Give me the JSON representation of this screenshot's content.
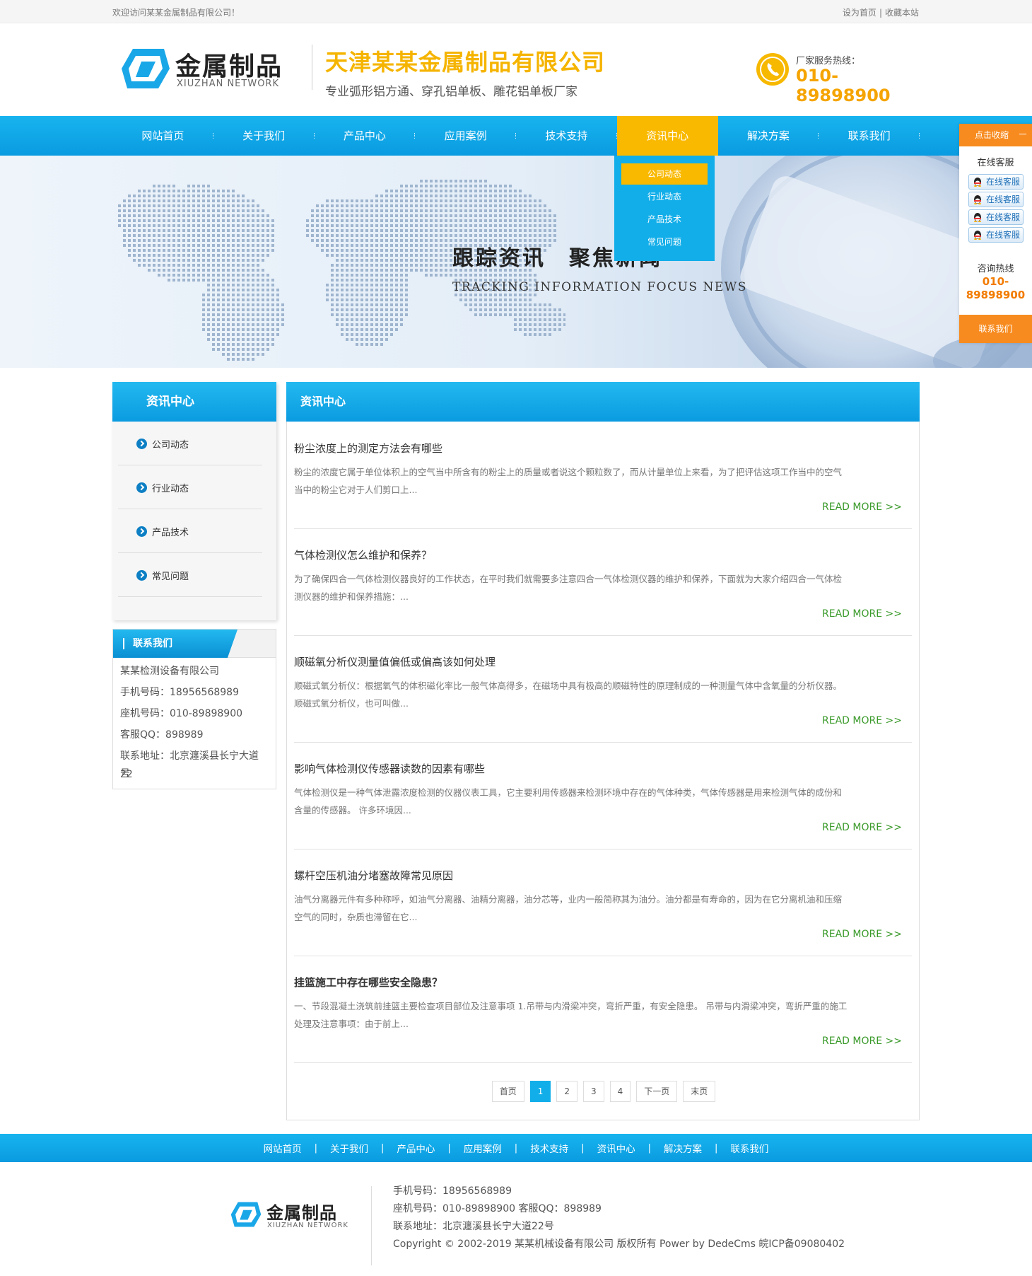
{
  "topbar": {
    "welcome": "欢迎访问某某金属制品有限公司！",
    "set_home": "设为首页",
    "separator": "|",
    "bookmark": "收藏本站"
  },
  "header": {
    "logo_cn": "金属制品",
    "logo_en": "XIUZHAN NETWORK",
    "company_name": "天津某某金属制品有限公司",
    "slogan": "专业弧形铝方通、穿孔铝单板、雕花铝单板厂家",
    "hotline_label": "厂家服务热线：",
    "hotline_number": "010-89898900"
  },
  "nav": {
    "items": [
      {
        "label": "网站首页"
      },
      {
        "label": "关于我们"
      },
      {
        "label": "产品中心"
      },
      {
        "label": "应用案例"
      },
      {
        "label": "技术支持"
      },
      {
        "label": "资讯中心"
      },
      {
        "label": "解决方案"
      },
      {
        "label": "联系我们"
      }
    ],
    "active_index": 5,
    "dropdown": [
      "公司动态",
      "行业动态",
      "产品技术",
      "常见问题"
    ]
  },
  "banner": {
    "title": "跟踪资讯　聚焦新闻",
    "subtitle": "TRACKING INFORMATION FOCUS NEWS"
  },
  "float_widget": {
    "toggle": "点击收缩",
    "toggle_symbol": "－",
    "online_title": "在线客服",
    "qq_buttons": [
      "在线客服",
      "在线客服",
      "在线客服",
      "在线客服"
    ],
    "hotline_label": "咨询热线",
    "hotline_line1": "010-",
    "hotline_line2": "89898900",
    "contact": "联系我们"
  },
  "sidebar": {
    "title": "资讯中心",
    "items": [
      "公司动态",
      "行业动态",
      "产品技术",
      "常见问题"
    ]
  },
  "contact": {
    "title": "联系我们",
    "company": "某某检测设备有限公司",
    "mobile": "手机号码：18956568989",
    "phone": "座机号码：010-89898900",
    "qq": "客服QQ：898989",
    "address_1": "联系地址：北京瀍溪县长宁大道22",
    "address_2": "号"
  },
  "main": {
    "title": "资讯中心",
    "read_more": "READ MORE >>",
    "articles": [
      {
        "title": "粉尘浓度上的测定方法会有哪些",
        "desc_1": "粉尘的浓度它属于单位体积上的空气当中所含有的粉尘上的质量或者说这个颗粒数了，而从计量单位上来看，为了把评估这项工作当中的空气",
        "desc_2": "当中的粉尘它对于人们剪口上..."
      },
      {
        "title": "气体检测仪怎么维护和保养？",
        "desc_1": "为了确保四合一气体检测仪器良好的工作状态，在平时我们就需要多注意四合一气体检测仪器的维护和保养，下面就为大家介绍四合一气体检",
        "desc_2": "测仪器的维护和保养措施：..."
      },
      {
        "title": "顺磁氧分析仪测量值偏低或偏高该如何处理",
        "desc_1": "顺磁式氧分析仪：根据氧气的体积磁化率比一般气体高得多，在磁场中具有极高的顺磁特性的原理制成的一种测量气体中含氧量的分析仪器。",
        "desc_2": "顺磁式氧分析仪，也可叫做..."
      },
      {
        "title": "影响气体检测仪传感器读数的因素有哪些",
        "desc_1": "气体检测仪是一种气体泄露浓度检测的仪器仪表工具，它主要利用传感器来检测环境中存在的气体种类，气体传感器是用来检测气体的成份和",
        "desc_2": "含量的传感器。 许多环境因..."
      },
      {
        "title": "螺杆空压机油分堵塞故障常见原因",
        "desc_1": "油气分离器元件有多种称呼，如油气分离器、油精分离器，油分芯等，业内一般简称其为油分。油分都是有寿命的，因为在它分离机油和压缩",
        "desc_2": "空气的同时，杂质也滞留在它..."
      },
      {
        "title": "挂篮施工中存在哪些安全隐患？",
        "desc_1": "一、节段混凝土浇筑前挂篮主要检查项目部位及注意事项 1.吊带与内滑梁冲突，弯折严重，有安全隐患。 吊带与内滑梁冲突，弯折严重的施工",
        "desc_2": "处理及注意事项：由于前上..."
      }
    ],
    "pager": [
      "首页",
      "1",
      "2",
      "3",
      "4",
      "下一页",
      "末页"
    ],
    "pager_active": 1
  },
  "footer_nav": {
    "items": [
      "网站首页",
      "关于我们",
      "产品中心",
      "应用案例",
      "技术支持",
      "资讯中心",
      "解决方案",
      "联系我们"
    ],
    "separator": "|"
  },
  "footer": {
    "logo_cn": "金属制品",
    "logo_en": "XIUZHAN NETWORK",
    "mobile": "手机号码：18956568989",
    "phone_qq": "座机号码：010-89898900 客服QQ：898989",
    "address": "联系地址：北京瀍溪县长宁大道22号",
    "copyright": "Copyright © 2002-2019 某某机械设备有限公司 版权所有 Power by DedeCms 皖ICP备09080402"
  },
  "colors": {
    "primary_blue": "#12aee9",
    "accent_yellow": "#f9b900",
    "orange": "#f78b1f",
    "read_more_green": "#3a9a2a"
  }
}
